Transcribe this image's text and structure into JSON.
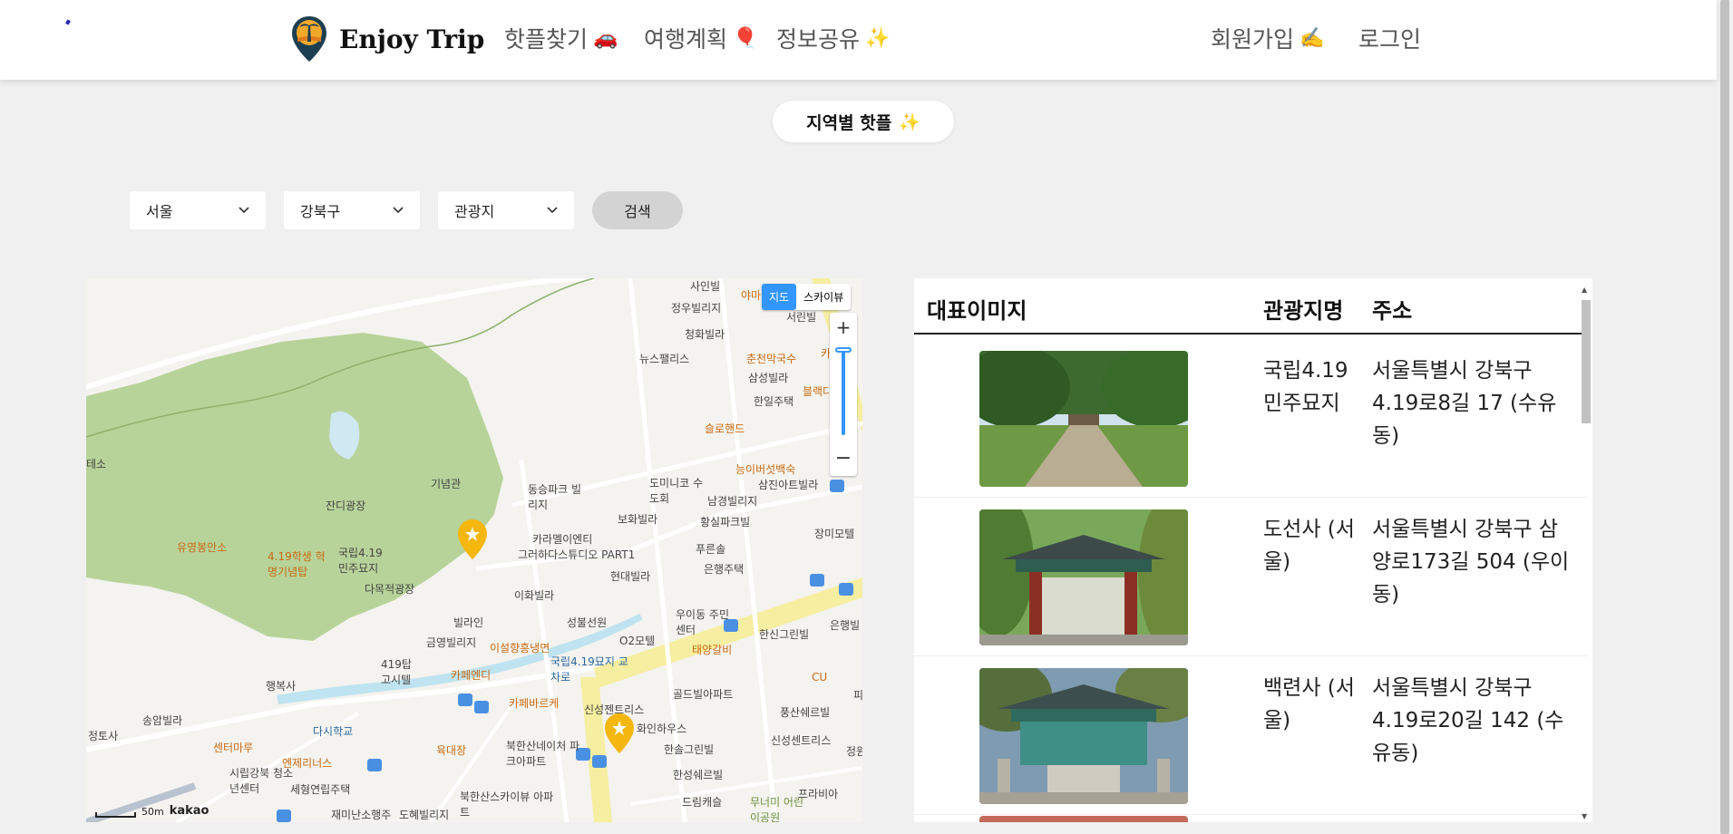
{
  "header": {
    "brand": "Enjoy Trip",
    "nav": [
      {
        "label": "핫플찾기",
        "emoji": "🚗"
      },
      {
        "label": "여행계획",
        "emoji": "🎈"
      },
      {
        "label": "정보공유",
        "emoji": "✨"
      }
    ],
    "signup": {
      "label": "회원가입",
      "emoji": "✍️"
    },
    "login": "로그인"
  },
  "title_pill": {
    "label": "지역별 핫플",
    "emoji": "✨"
  },
  "filters": {
    "city": "서울",
    "district": "강북구",
    "category": "관광지",
    "search_button": "검색"
  },
  "map": {
    "type_buttons": [
      "지도",
      "스카이뷰"
    ],
    "scale_label": "50m",
    "provider": "kakao",
    "labels": {
      "l1": "사인빌",
      "l2": "정우빌리지",
      "l3": "청화빌라",
      "l4": "뉴스팰리스",
      "l5": "춘천막국수",
      "l6": "삼성빌라",
      "l7": "한일주택",
      "l8": "슬로핸드",
      "l9": "능이버섯백숙",
      "l10": "삼진아트빌라",
      "l11": "도미니코 수도회",
      "l12": "남경빌리지",
      "l13": "황실파크빌",
      "l14": "기념관",
      "l15": "잔디광장",
      "l16": "동승파크 빌리지",
      "l17": "카라멜이엔티",
      "l18": "그러하다스튜디오 PART1",
      "l19": "보화빌라",
      "l20": "푸른솔",
      "l21": "은행주택",
      "l22": "장미모텔",
      "l23": "유영봉안소",
      "l24": "4.19학생 혁명기념탑",
      "l25": "국립4.19 민주묘지",
      "l26": "다목적광장",
      "l27": "현대빌라",
      "l28": "이화빌라",
      "l29": "빌라인",
      "l30": "성불선원",
      "l31": "우이동 주민센터",
      "l32": "한신그린빌",
      "l33": "은행빌",
      "l34": "금영빌리지",
      "l35": "이설향흥냉면",
      "l36": "O2모텔",
      "l37": "태양갈비",
      "l38": "419탑 고시텔",
      "l39": "카페엔디",
      "l40": "국립4.19묘지 교차로",
      "l41": "행복사",
      "l42": "카페바르케",
      "l43": "신성젠트리스",
      "l44": "골드빌아파트",
      "l45": "풍산쉐르빌",
      "l46": "송암빌라",
      "l47": "다시학교",
      "l48": "화인하우스",
      "l49": "정토사",
      "l50": "센터마루",
      "l51": "육대장",
      "l52": "북한산네이처 파크아파트",
      "l53": "한솔그린빌",
      "l54": "신성센트리스",
      "l55": "엔제리너스",
      "l56": "시립강북 청소년센터",
      "l57": "세형연립주택",
      "l58": "한성쉐르빌",
      "l59": "북한산스카이뷰 아파트",
      "l60": "드림캐슬",
      "l61": "무너미 어린이공원",
      "l62": "프라비아",
      "l63": "재미난소행주",
      "l64": "도혜빌리지",
      "l65": "테소",
      "l66": "CU",
      "l67": "정원",
      "l68": "피",
      "l69": "블랙다",
      "l70": "야마",
      "l71": "서린빌",
      "l72": "카"
    }
  },
  "table": {
    "headers": [
      "대표이미지",
      "관광지명",
      "주소"
    ],
    "rows": [
      {
        "name": "국립4.19 민주묘지",
        "address": "서울특별시 강북구 4.19로8길 17 (수유동)"
      },
      {
        "name": "도선사 (서울)",
        "address": "서울특별시 강북구 삼양로173길 504 (우이동)"
      },
      {
        "name": "백련사 (서울)",
        "address": "서울특별시 강북구 4.19로20길 142 (수유동)"
      }
    ]
  },
  "colors": {
    "accent": "#3396ff",
    "park": "#a9d08f",
    "road_yellow": "#f6eea0",
    "stream": "#bfe3f0"
  }
}
